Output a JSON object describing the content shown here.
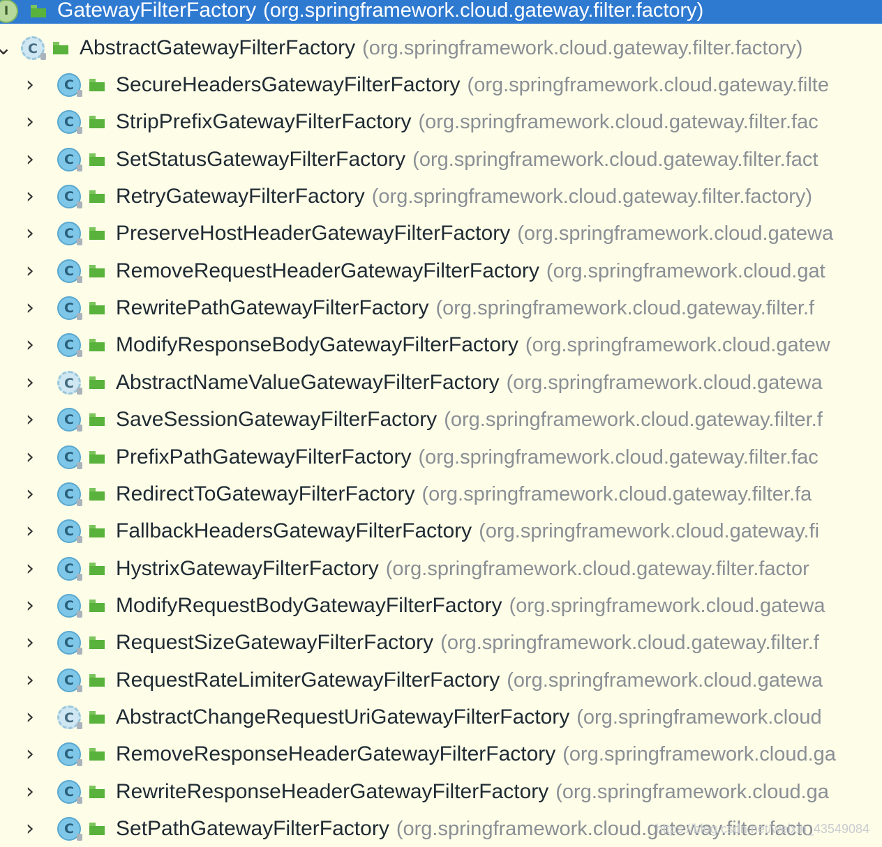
{
  "selected": {
    "name": "GatewayFilterFactory",
    "package": "(org.springframework.cloud.gateway.filter.factory)",
    "icon": "interface-icon",
    "icon_letter": "I"
  },
  "parent": {
    "name": "AbstractGatewayFilterFactory",
    "package": "(org.springframework.cloud.gateway.filter.factory)",
    "icon_letter": "C"
  },
  "children": [
    {
      "name": "SecureHeadersGatewayFilterFactory",
      "package": "(org.springframework.cloud.gateway.filte",
      "abstract": false
    },
    {
      "name": "StripPrefixGatewayFilterFactory",
      "package": "(org.springframework.cloud.gateway.filter.fac",
      "abstract": false
    },
    {
      "name": "SetStatusGatewayFilterFactory",
      "package": "(org.springframework.cloud.gateway.filter.fact",
      "abstract": false
    },
    {
      "name": "RetryGatewayFilterFactory",
      "package": "(org.springframework.cloud.gateway.filter.factory)",
      "abstract": false
    },
    {
      "name": "PreserveHostHeaderGatewayFilterFactory",
      "package": "(org.springframework.cloud.gatewa",
      "abstract": false
    },
    {
      "name": "RemoveRequestHeaderGatewayFilterFactory",
      "package": "(org.springframework.cloud.gat",
      "abstract": false
    },
    {
      "name": "RewritePathGatewayFilterFactory",
      "package": "(org.springframework.cloud.gateway.filter.f",
      "abstract": false
    },
    {
      "name": "ModifyResponseBodyGatewayFilterFactory",
      "package": "(org.springframework.cloud.gatew",
      "abstract": false
    },
    {
      "name": "AbstractNameValueGatewayFilterFactory",
      "package": "(org.springframework.cloud.gatewa",
      "abstract": true
    },
    {
      "name": "SaveSessionGatewayFilterFactory",
      "package": "(org.springframework.cloud.gateway.filter.f",
      "abstract": false
    },
    {
      "name": "PrefixPathGatewayFilterFactory",
      "package": "(org.springframework.cloud.gateway.filter.fac",
      "abstract": false
    },
    {
      "name": "RedirectToGatewayFilterFactory",
      "package": "(org.springframework.cloud.gateway.filter.fa",
      "abstract": false
    },
    {
      "name": "FallbackHeadersGatewayFilterFactory",
      "package": "(org.springframework.cloud.gateway.fi",
      "abstract": false
    },
    {
      "name": "HystrixGatewayFilterFactory",
      "package": "(org.springframework.cloud.gateway.filter.factor",
      "abstract": false
    },
    {
      "name": "ModifyRequestBodyGatewayFilterFactory",
      "package": "(org.springframework.cloud.gatewa",
      "abstract": false
    },
    {
      "name": "RequestSizeGatewayFilterFactory",
      "package": "(org.springframework.cloud.gateway.filter.f",
      "abstract": false
    },
    {
      "name": "RequestRateLimiterGatewayFilterFactory",
      "package": "(org.springframework.cloud.gatewa",
      "abstract": false
    },
    {
      "name": "AbstractChangeRequestUriGatewayFilterFactory",
      "package": "(org.springframework.cloud",
      "abstract": true
    },
    {
      "name": "RemoveResponseHeaderGatewayFilterFactory",
      "package": "(org.springframework.cloud.ga",
      "abstract": false
    },
    {
      "name": "RewriteResponseHeaderGatewayFilterFactory",
      "package": "(org.springframework.cloud.ga",
      "abstract": false
    },
    {
      "name": "SetPathGatewayFilterFactory",
      "package": "(org.springframework.cloud.gateway.filter.facto",
      "abstract": false
    }
  ],
  "child_icon_letter": "C",
  "expand_glyph": "›",
  "collapse_glyph": "⌄",
  "watermark": "https://blog.csdn.net/weixin_43549084",
  "colors": {
    "background": "#fdfde8",
    "selection": "#2f7ad1",
    "class_icon": "#7fc7e8",
    "package_icon": "#59b23b",
    "package_text": "#8a8f95"
  }
}
